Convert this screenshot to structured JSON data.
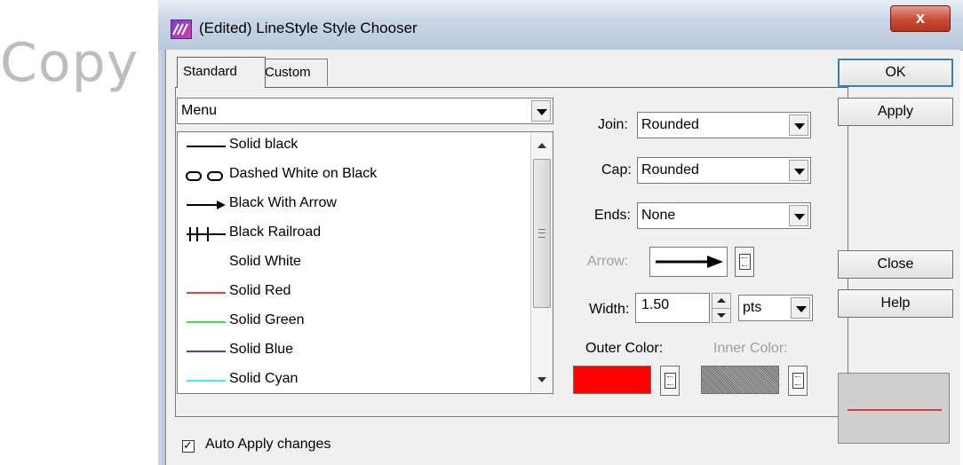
{
  "window": {
    "title": "(Edited) LineStyle Style Chooser",
    "close_label": "x"
  },
  "watermark": {
    "text": "Copy"
  },
  "tabs": [
    {
      "label": "Standard",
      "active": true
    },
    {
      "label": "Custom",
      "active": false
    }
  ],
  "style_menu": {
    "value": "Menu"
  },
  "styles": [
    {
      "label": "Solid black"
    },
    {
      "label": "Dashed White on Black"
    },
    {
      "label": "Black With Arrow"
    },
    {
      "label": "Black Railroad"
    },
    {
      "label": "Solid White"
    },
    {
      "label": "Solid Red"
    },
    {
      "label": "Solid Green"
    },
    {
      "label": "Solid Blue"
    },
    {
      "label": "Solid Cyan"
    }
  ],
  "join": {
    "label": "Join:",
    "value": "Rounded"
  },
  "cap": {
    "label": "Cap:",
    "value": "Rounded"
  },
  "ends": {
    "label": "Ends:",
    "value": "None"
  },
  "arrow": {
    "label": "Arrow:"
  },
  "width": {
    "label": "Width:",
    "value": "1.50",
    "unit": "pts"
  },
  "outer_color": {
    "label": "Outer Color:",
    "color": "#ff0000"
  },
  "inner_color": {
    "label": "Inner Color:"
  },
  "buttons": {
    "ok": "OK",
    "apply": "Apply",
    "close": "Close",
    "help": "Help"
  },
  "auto_apply": {
    "label": "Auto Apply changes",
    "checked": true
  },
  "colors": {
    "red": "#e23a3a",
    "green": "#44dd44",
    "blue": "#4444dd",
    "cyan": "#44eeee"
  }
}
